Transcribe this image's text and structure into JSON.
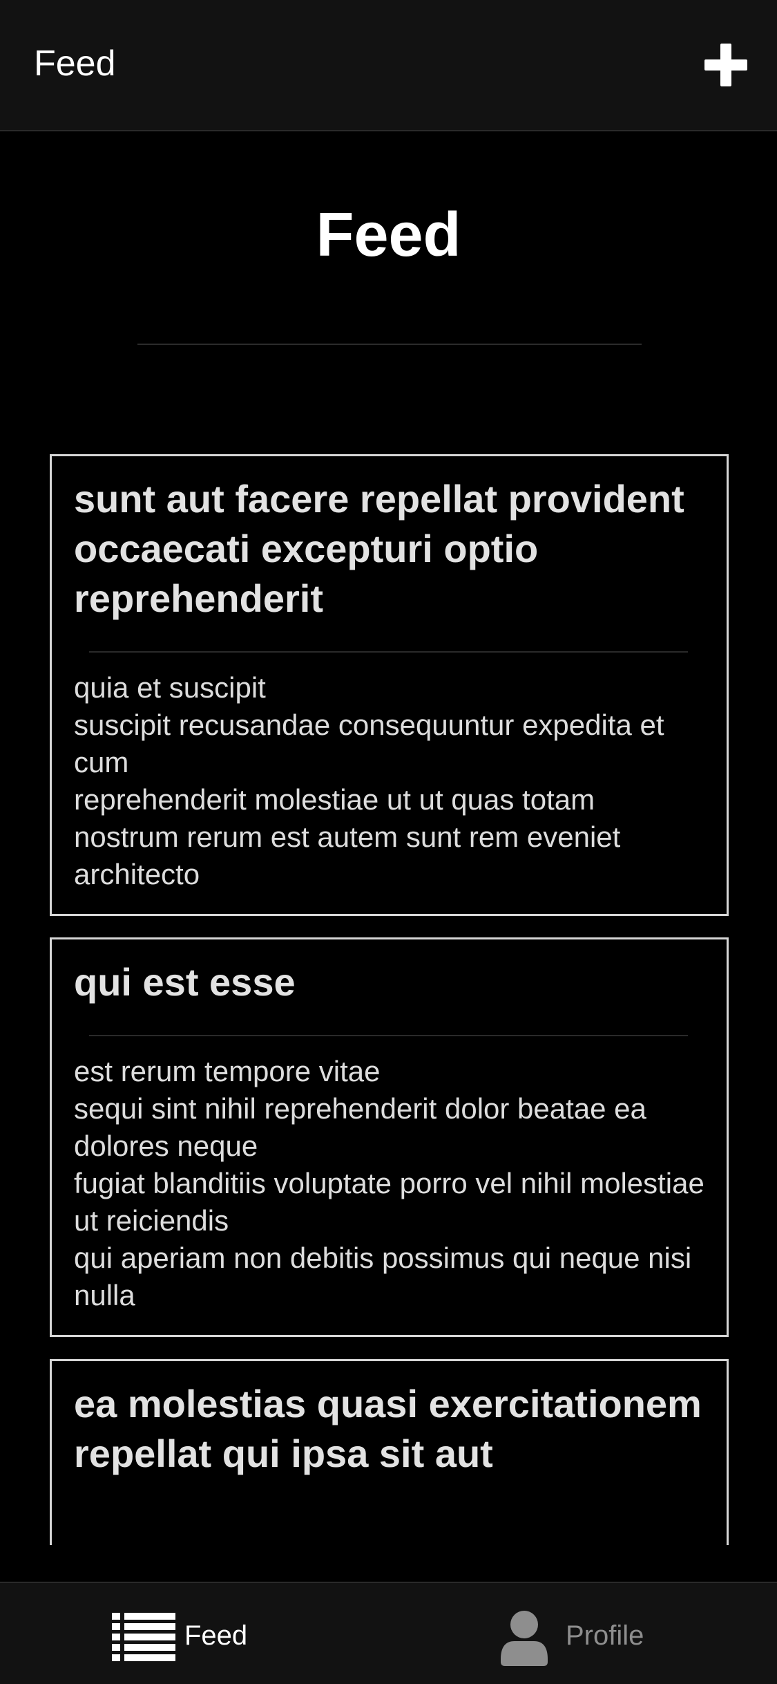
{
  "header": {
    "title": "Feed",
    "add_icon": "plus-icon"
  },
  "main": {
    "title": "Feed",
    "posts": [
      {
        "title": "sunt aut facere repellat provident occaecati excepturi optio reprehenderit",
        "body": "quia et suscipit\nsuscipit recusandae consequuntur expedita et cum\nreprehenderit molestiae ut ut quas totam\nnostrum rerum est autem sunt rem eveniet architecto"
      },
      {
        "title": "qui est esse",
        "body": "est rerum tempore vitae\nsequi sint nihil reprehenderit dolor beatae ea dolores neque\nfugiat blanditiis voluptate porro vel nihil molestiae ut reiciendis\nqui aperiam non debitis possimus qui neque nisi nulla"
      },
      {
        "title": "ea molestias quasi exercitationem repellat qui ipsa sit aut",
        "body": ""
      }
    ]
  },
  "tabbar": {
    "tabs": [
      {
        "label": "Feed",
        "icon": "list-icon",
        "active": true
      },
      {
        "label": "Profile",
        "icon": "user-icon",
        "active": false
      }
    ]
  },
  "colors": {
    "background": "#000000",
    "bar_background": "#121212",
    "card_border": "#d6d6d6",
    "active_tab": "#ffffff",
    "inactive_tab": "#8e8e8e"
  }
}
